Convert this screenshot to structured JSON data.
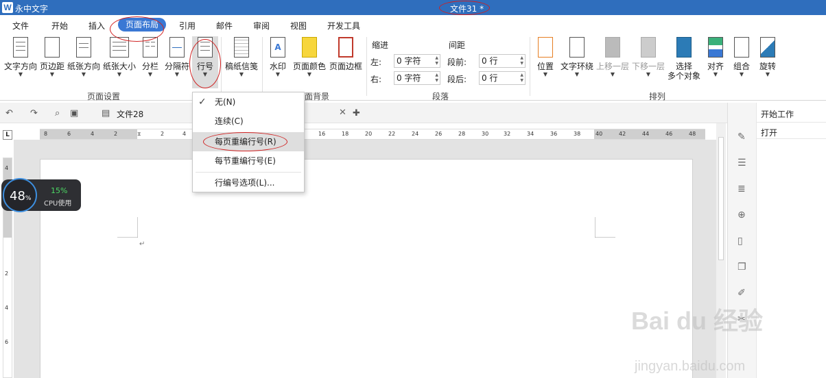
{
  "app": {
    "name": "永中文字",
    "logo": "W"
  },
  "window": {
    "title": "文件31 *"
  },
  "menu": [
    "文件",
    "开始",
    "插入",
    "页面布局",
    "引用",
    "邮件",
    "审阅",
    "视图",
    "开发工具"
  ],
  "menu_active": "页面布局",
  "ribbon": {
    "page_setup": [
      "文字方向",
      "页边距",
      "纸张方向",
      "纸张大小",
      "分栏",
      "分隔符",
      "行号"
    ],
    "manuscript": "稿纸信笺",
    "background": [
      "水印",
      "页面颜色",
      "页面边框"
    ],
    "indent": {
      "title": "缩进",
      "left_label": "左:",
      "left_value": "0 字符",
      "right_label": "右:",
      "right_value": "0 字符"
    },
    "spacing": {
      "title": "间距",
      "before_label": "段前:",
      "before_value": "0 行",
      "after_label": "段后:",
      "after_value": "0 行"
    },
    "arrange": [
      "位置",
      "文字环绕",
      "上移一层",
      "下移一层",
      "选择\n多个对象",
      "对齐",
      "组合",
      "旋转"
    ],
    "arrange_select_line1": "选择",
    "arrange_select_line2": "多个对象",
    "groups": {
      "page_setup": "页面设置",
      "background_partial": "面背景",
      "paragraph": "段落",
      "arrange": "排列"
    }
  },
  "doc_tab": {
    "name": "文件28"
  },
  "dropdown": {
    "items": [
      {
        "label": "无(N)",
        "checked": true
      },
      {
        "label": "连续(C)"
      },
      {
        "label": "每页重编行号(R)",
        "hovered": true
      },
      {
        "label": "每节重编行号(E)"
      },
      {
        "label": "行编号选项(L)..."
      }
    ]
  },
  "right_panel": {
    "title": "开始工作",
    "open": "打开",
    "icons": [
      "pencil-icon",
      "sliders-icon",
      "list-icon",
      "lock-icon",
      "clipboard-icon",
      "copy-icon",
      "edit-icon",
      "tools-icon"
    ]
  },
  "ruler": {
    "h_ticks": [
      "8",
      "6",
      "4",
      "2",
      "",
      "2",
      "4",
      "16",
      "18",
      "20",
      "22",
      "24",
      "26",
      "28",
      "30",
      "32",
      "34",
      "36",
      "38",
      "40",
      "42",
      "44",
      "46",
      "48"
    ],
    "v_ticks": [
      "4",
      "2",
      "",
      "2",
      "4",
      "6"
    ]
  },
  "cpu": {
    "percent": "48",
    "unit": "%",
    "value": "15%",
    "label": "CPU使用"
  },
  "watermark": {
    "line1": "Bai du 经验",
    "line2": "jingyan.baidu.com"
  },
  "colors": {
    "titlebar": "#2f6ebd",
    "active_tab": "#3a78d4",
    "annotation": "#d02020"
  }
}
